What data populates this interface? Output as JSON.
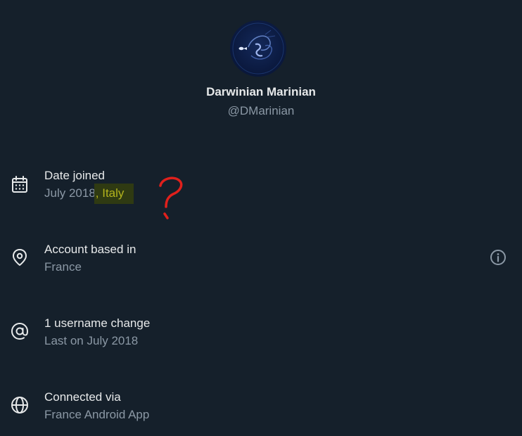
{
  "profile": {
    "display_name": "Darwinian Marinian",
    "handle": "@DMarinian"
  },
  "rows": {
    "date_joined": {
      "title": "Date joined",
      "value": "July 2018",
      "highlighted_text": ", Italy",
      "icon": "calendar-icon"
    },
    "account_based": {
      "title": "Account based in",
      "value": "France",
      "icon": "location-pin-icon",
      "action_icon": "info-icon"
    },
    "username_change": {
      "title": "1 username change",
      "value": "Last on July 2018",
      "icon": "at-sign-icon"
    },
    "connected_via": {
      "title": "Connected via",
      "value": "France Android App",
      "icon": "globe-icon"
    }
  },
  "annotation": {
    "mark": "question-mark",
    "color": "#e0201c"
  },
  "colors": {
    "background": "#15202b",
    "primary_text": "#e7e9ea",
    "secondary_text": "#8b98a5",
    "highlight_background": "#2f3a12",
    "highlight_text": "#b3b31c"
  }
}
